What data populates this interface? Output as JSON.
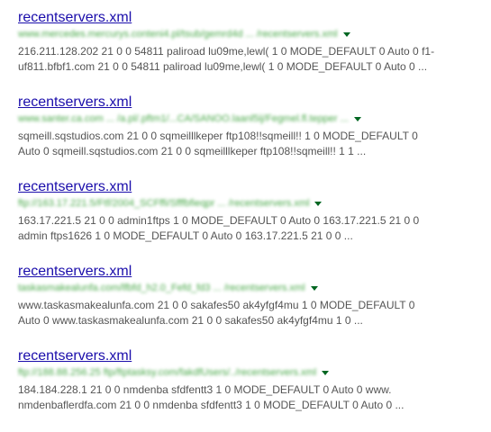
{
  "results": [
    {
      "title": "recentservers.xml",
      "url": "www.mercedes.mercurys.conteni4.pl/tsub/gemrd4d ... /recentservers.xml",
      "snippet": [
        "216.211.128.202 21 0 0 54811 paliroad lu09me,lewl( 1 0 MODE_DEFAULT 0 Auto 0 f1-",
        "uf811.bfbf1.com 21 0 0 54811 paliroad lu09me,lewl( 1 0 MODE_DEFAULT 0 Auto 0 ..."
      ]
    },
    {
      "title": "recentservers.xml",
      "url": "www.santer.ca.com ... /a.pl/.pftm1/...CA/SANOO.laanl5ij/Fegmel.fl.tepper ...",
      "snippet": [
        "sqmeill.sqstudios.com 21 0 0 sqmeilllkeper ftp108!!sqmeill!! 1 0 MODE_DEFAULT 0",
        "Auto 0 sqmeill.sqstudios.com 21 0 0 sqmeilllkeper ftp108!!sqmeill!! 1 1 ..."
      ]
    },
    {
      "title": "recentservers.xml",
      "url": "ftp://163.17.221.5/Ftf/2004_SCFffi/Sfffbfieqpr ... /recentservers.xml",
      "snippet": [
        "163.17.221.5 21 0 0 admin1ftps 1 0 MODE_DEFAULT 0 Auto 0 163.17.221.5 21 0 0",
        "admin ftps1626 1 0 MODE_DEFAULT 0 Auto 0 163.17.221.5 21 0 0 ..."
      ]
    },
    {
      "title": "recentservers.xml",
      "url": "taskasmakealunfa.com/lfbfd_h2.0_Fefd_fd3 ... /recentservers.xml",
      "snippet": [
        "www.taskasmakealunfa.com 21 0 0 sakafes50 ak4yfgf4mu 1 0 MODE_DEFAULT 0",
        "Auto 0 www.taskasmakealunfa.com 21 0 0 sakafes50 ak4yfgf4mu 1 0 ..."
      ]
    },
    {
      "title": "recentservers.xml",
      "url": "ftp://188.88.256.25 ftp/ftptasksy.com/fakdfUsers/../recentservers.xml",
      "snippet": [
        "184.184.228.1 21 0 0 nmdenba sfdfentt3 1 0 MODE_DEFAULT 0 Auto 0 www.",
        "nmdenbaflerdfa.com 21 0 0 nmdenba sfdfentt3 1 0 MODE_DEFAULT 0 Auto 0 ..."
      ]
    }
  ]
}
